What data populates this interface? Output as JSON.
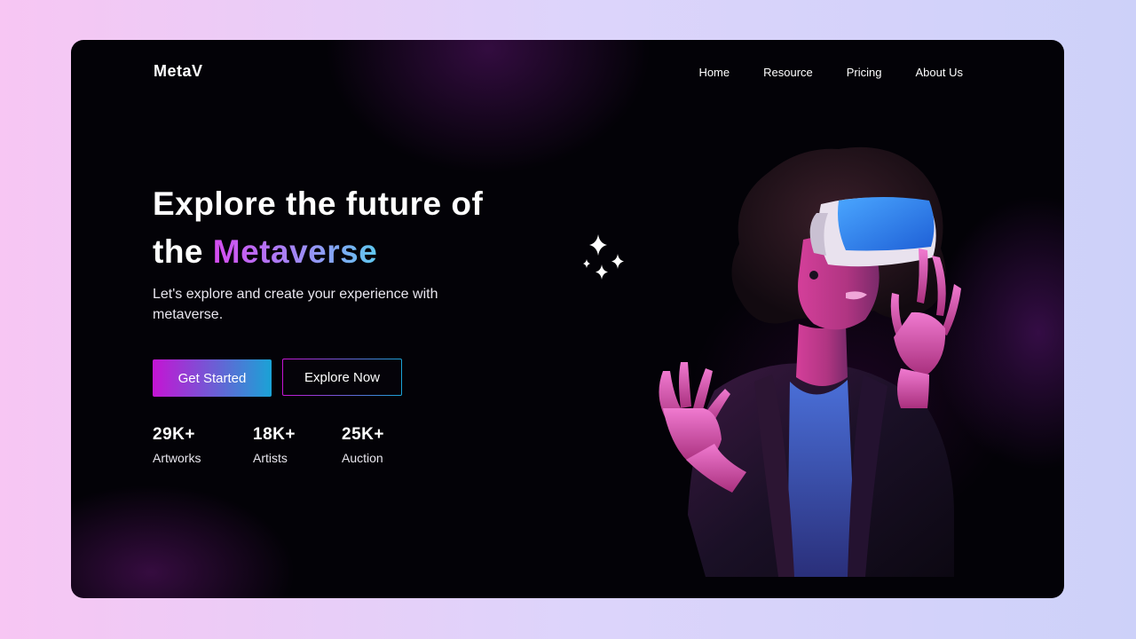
{
  "brand": {
    "logo": "MetaV"
  },
  "nav": {
    "items": [
      {
        "label": "Home"
      },
      {
        "label": "Resource"
      },
      {
        "label": "Pricing"
      },
      {
        "label": "About Us"
      }
    ]
  },
  "hero": {
    "headline_part1": "Explore the future of",
    "headline_part2": "the",
    "headline_highlight": "Metaverse",
    "subtitle": "Let's explore and create your experience with metaverse.",
    "cta_primary": "Get Started",
    "cta_secondary": "Explore Now"
  },
  "stats": [
    {
      "value": "29K+",
      "label": "Artworks"
    },
    {
      "value": "18K+",
      "label": "Artists"
    },
    {
      "value": "25K+",
      "label": "Auction"
    }
  ],
  "colors": {
    "gradient_start": "#c514d4",
    "gradient_end": "#1aa3d6",
    "card_background": "#030207"
  },
  "icons": {
    "sparkles": "sparkles-icon"
  },
  "images": {
    "hero": "woman-wearing-vr-headset"
  }
}
